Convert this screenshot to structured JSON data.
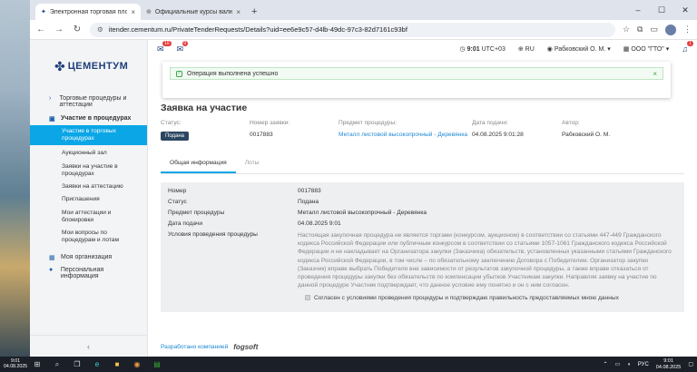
{
  "browser": {
    "tabs": [
      {
        "title": "Электронная торговая площ...",
        "active": true
      },
      {
        "title": "Официальные курсы валют н...",
        "active": false
      }
    ],
    "url": "itender.cementum.ru/PrivateTenderRequests/Details?uid=ee6e9c57-d4lb-49dc-97c3-82d7161c93bf"
  },
  "logo": {
    "name": "ЦЕМЕНТУМ"
  },
  "sidebar": {
    "groups": [
      {
        "label": "Торговые процедуры и аттестации"
      },
      {
        "label": "Участие в процедурах"
      },
      {
        "label": "Моя организация"
      },
      {
        "label": "Персональная информация"
      }
    ],
    "items": [
      {
        "label": "Участие в торговых процедурах",
        "active": true
      },
      {
        "label": "Аукционный зал"
      },
      {
        "label": "Заявки на участие в процедурах"
      },
      {
        "label": "Заявки на аттестацию"
      },
      {
        "label": "Приглашения"
      },
      {
        "label": "Мои аттестации и блокировки"
      },
      {
        "label": "Мои вопросы по процедурам и лотам"
      }
    ]
  },
  "topbar": {
    "msg_count": "10",
    "notif_count": "0",
    "time": "9:01",
    "tz": "UTC+03",
    "lang": "RU",
    "user": "Рабковский О. М.",
    "org": "ООО \"ГТО\"",
    "bell_count": "1"
  },
  "toast": {
    "message": "Операция выполнена успешно"
  },
  "page": {
    "title": "Заявка на участие",
    "meta_labels": {
      "status": "Статус:",
      "number": "Номер заявки:",
      "procedure": "Предмет процедуры:",
      "date": "Дата подачи:",
      "author": "Автор:"
    },
    "meta_values": {
      "status": "Подана",
      "number": "0017883",
      "procedure": "Металл листовой высокопрочный - Деревянка",
      "date": "04.08.2025 9:01:28",
      "author": "Рабковский О. М."
    },
    "tabs": [
      "Общая информация",
      "Лоты"
    ]
  },
  "details": {
    "rows": [
      {
        "k": "Номер",
        "v": "0017883"
      },
      {
        "k": "Статус",
        "v": "Подана"
      },
      {
        "k": "Предмет процедуры",
        "v": "Металл листовой высокопрочный - Деревянка"
      },
      {
        "k": "Дата подачи",
        "v": "04.08.2025 9:01"
      },
      {
        "k": "Условия проведения процедуры",
        "v": "Настоящая закупочная процедура не является торгами (конкурсом, аукционом) в соответствии со статьями 447-449 Гражданского кодекса Российской Федерации или публичным конкурсом в соответствии со статьями 1057-1061 Гражданского кодекса Российской Федерации и не накладывает на Организатора закупки (Заказчика) обязательств, установленных указанными статьями Гражданского кодекса Российской Федерации, в том числе – по обязательному заключению Договора с Победителем. Организатор закупки (Заказчик) вправе выбрать Победителя вне зависимости от результатов закупочной процедуры, а также вправе отказаться от проведения процедуры закупки без обязательств по компенсации убытков Участникам закупки. Направляя заявку на участие по данной процедуре Участник подтверждает, что данное условие ему понятно и он с ним согласен."
      }
    ],
    "agree": "Согласен с условиями проведения процедуры и подтверждаю правильность предоставляемых мною данных"
  },
  "footer": {
    "developed": "Разработано компанией",
    "brand": "fogsoft"
  },
  "taskbar": {
    "left_time": "9:01",
    "left_date": "04.08.2025",
    "lang": "РУС",
    "time": "9:01",
    "date": "04.08.2025"
  }
}
